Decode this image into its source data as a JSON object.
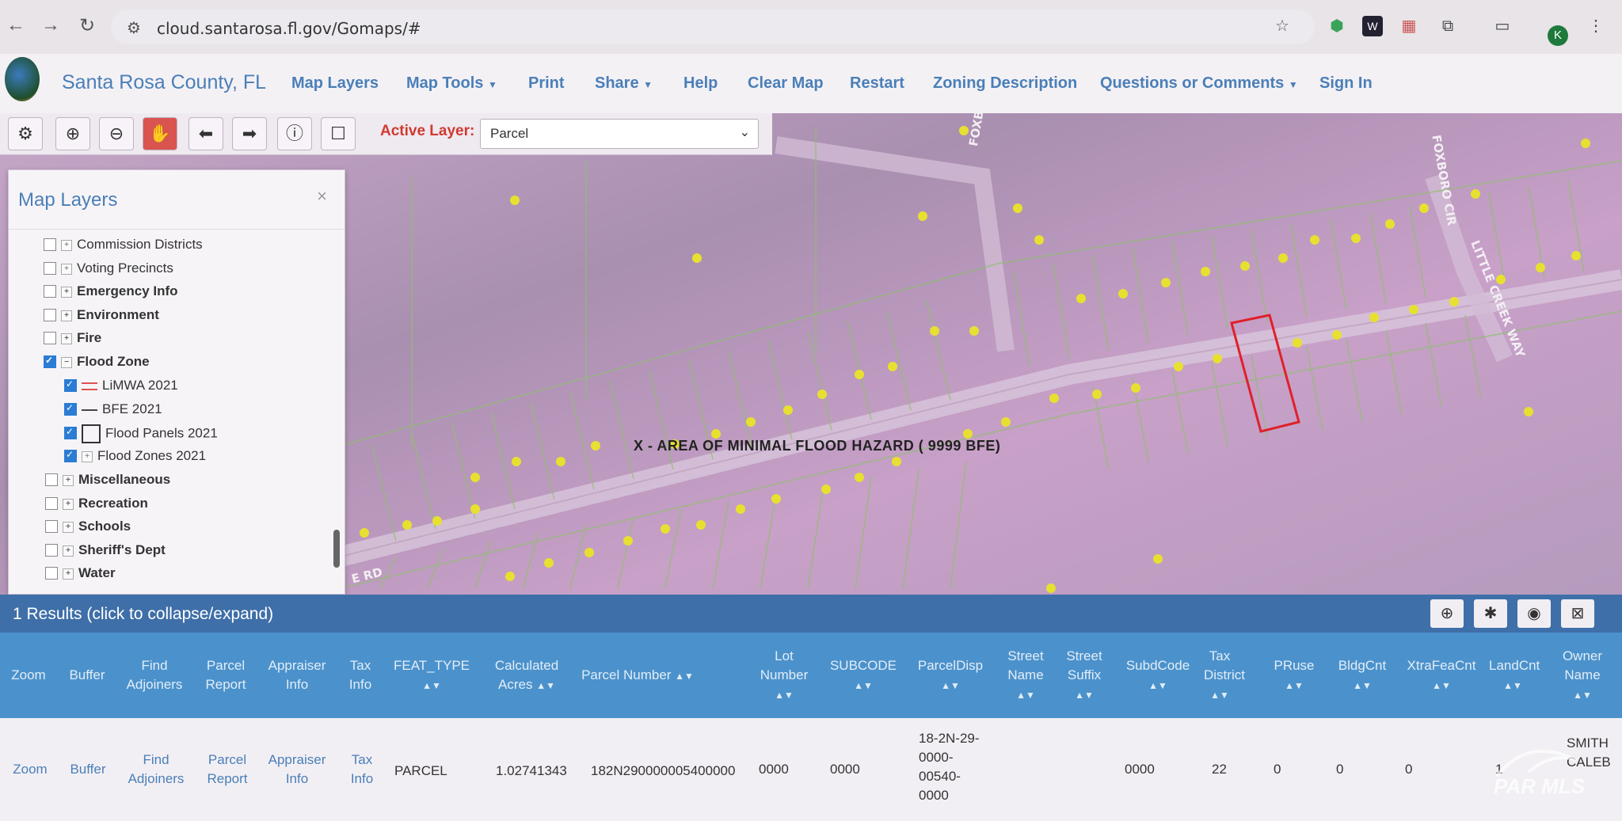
{
  "browser": {
    "url": "cloud.santarosa.fl.gov/Gomaps/#",
    "avatar_initial": "K"
  },
  "header": {
    "site_title": "Santa Rosa County, FL",
    "menu": [
      {
        "label": "Map Layers"
      },
      {
        "label": "Map Tools"
      },
      {
        "label": "Print"
      },
      {
        "label": "Share"
      },
      {
        "label": "Help"
      },
      {
        "label": "Clear Map"
      },
      {
        "label": "Restart"
      },
      {
        "label": "Zoning Description"
      },
      {
        "label": "Questions or Comments"
      },
      {
        "label": "Sign In"
      }
    ]
  },
  "toolbar": {
    "active_layer_label": "Active Layer:",
    "active_layer_value": "Parcel"
  },
  "map": {
    "flood_label": "X - AREA OF MINIMAL FLOOD HAZARD  ( 9999 BFE)",
    "streets": [
      "FOXBORO",
      "FOXBORO CIR",
      "LITTLE CREEK WAY",
      "E RD"
    ]
  },
  "layers_panel": {
    "title": "Map Layers",
    "close": "×",
    "items": [
      {
        "label": "Commission Districts",
        "checked": false
      },
      {
        "label": "Voting Precincts",
        "checked": false
      },
      {
        "label": "Emergency Info",
        "checked": false
      },
      {
        "label": "Environment",
        "checked": false
      },
      {
        "label": "Fire",
        "checked": false
      },
      {
        "label": "Flood Zone",
        "checked": true
      },
      {
        "label": "LiMWA 2021",
        "checked": true
      },
      {
        "label": "BFE 2021",
        "checked": true
      },
      {
        "label": "Flood Panels 2021",
        "checked": true
      },
      {
        "label": "Flood Zones 2021",
        "checked": true
      },
      {
        "label": "Miscellaneous",
        "checked": false
      },
      {
        "label": "Recreation",
        "checked": false
      },
      {
        "label": "Schools",
        "checked": false
      },
      {
        "label": "Sheriff's Dept",
        "checked": false
      },
      {
        "label": "Water",
        "checked": false
      }
    ]
  },
  "results": {
    "title": "1 Results (click to collapse/expand)",
    "columns": [
      "Zoom",
      "Buffer",
      "Find Adjoiners",
      "Parcel Report",
      "Appraiser Info",
      "Tax Info",
      "FEAT_TYPE",
      "Calculated Acres",
      "Parcel Number",
      "Lot Number",
      "SUBCODE",
      "ParcelDisp",
      "Street Name",
      "Street Suffix",
      "SubdCode",
      "Tax District",
      "PRuse",
      "BldgCnt",
      "XtraFeaCnt",
      "LandCnt",
      "Owner Name"
    ],
    "row": {
      "zoom": "Zoom",
      "buffer": "Buffer",
      "find_adjoiners": "Find Adjoiners",
      "parcel_report": "Parcel Report",
      "appraiser_info": "Appraiser Info",
      "tax_info": "Tax Info",
      "feat_type": "PARCEL",
      "calculated_acres": "1.02741343",
      "parcel_number": "182N290000005400000",
      "lot_number": "0000",
      "subcode": "0000",
      "parcel_disp": "18-2N-29-0000-00540-0000",
      "street_name": "",
      "street_suffix": "",
      "subd_code": "0000",
      "tax_district": "22",
      "pruse": "0",
      "bldg_cnt": "0",
      "xtra_fea_cnt": "0",
      "land_cnt": "1",
      "owner_name": "SMITH CALEB"
    }
  },
  "watermark": "PAR MLS"
}
